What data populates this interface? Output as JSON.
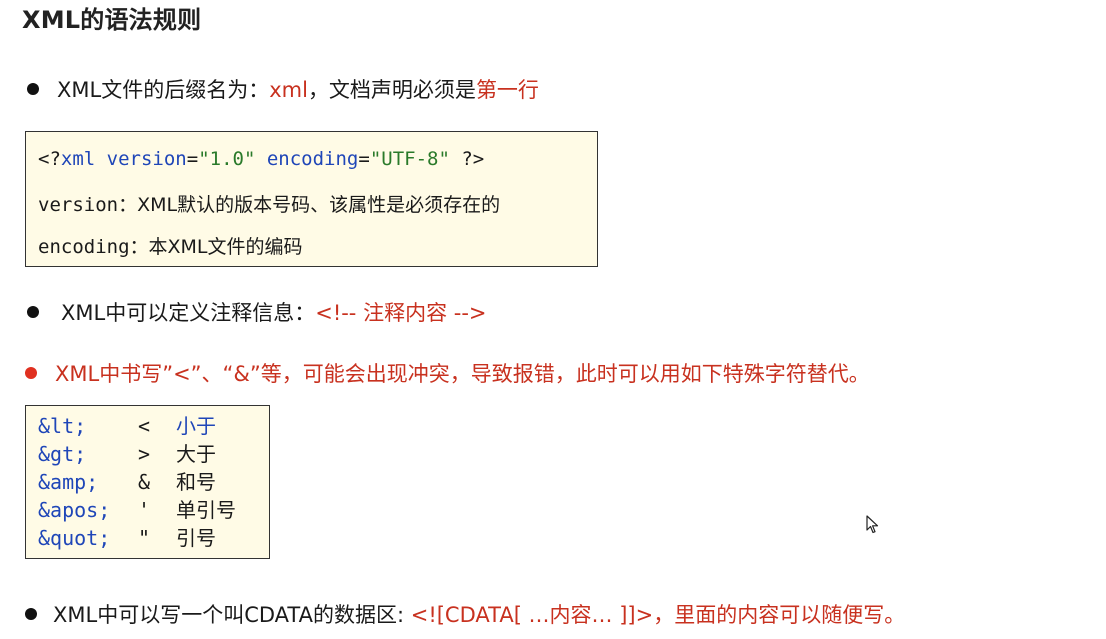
{
  "title": "XML的语法规则",
  "bullet1": {
    "prefix": "XML文件的后缀名为：",
    "ext": "xml",
    "middle": "，文档声明必须是",
    "highlight": "第一行"
  },
  "decl": {
    "open": "<?",
    "xml": "xml",
    "sp1": " ",
    "version_attr": "version",
    "eq1": "=",
    "version_val": "\"1.0\"",
    "sp2": " ",
    "encoding_attr": "encoding",
    "eq2": "=",
    "encoding_val": "\"UTF-8\"",
    "close": " ?>",
    "version_label": "version：",
    "version_desc": "XML默认的版本号码、该属性是必须存在的",
    "encoding_label": "encoding：",
    "encoding_desc": "本XML文件的编码"
  },
  "bullet2": {
    "prefix": "XML中可以定义注释信息：",
    "comment": "<!-- 注释内容 -->"
  },
  "bullet3": {
    "text": "XML中书写”<”、“&”等，可能会出现冲突，导致报错，此时可以用如下特殊字符替代。"
  },
  "entities": [
    {
      "code": "&lt;",
      "char": "<",
      "desc": "小于"
    },
    {
      "code": "&gt;",
      "char": ">",
      "desc": "大于"
    },
    {
      "code": "&amp;",
      "char": "&",
      "desc": "和号"
    },
    {
      "code": "&apos;",
      "char": "'",
      "desc": "单引号"
    },
    {
      "code": "&quot;",
      "char": "\"",
      "desc": "引号"
    }
  ],
  "bullet4": {
    "prefix": "XML中可以写一个叫CDATA的数据区: ",
    "cdata": "<![CDATA[ …内容… ]]>",
    "suffix": "，里面的内容可以随便写。"
  },
  "colors": {
    "red": "#c8311f",
    "blue": "#1f46b8",
    "green": "#2a7a2a",
    "box_bg": "#fffbe6"
  }
}
